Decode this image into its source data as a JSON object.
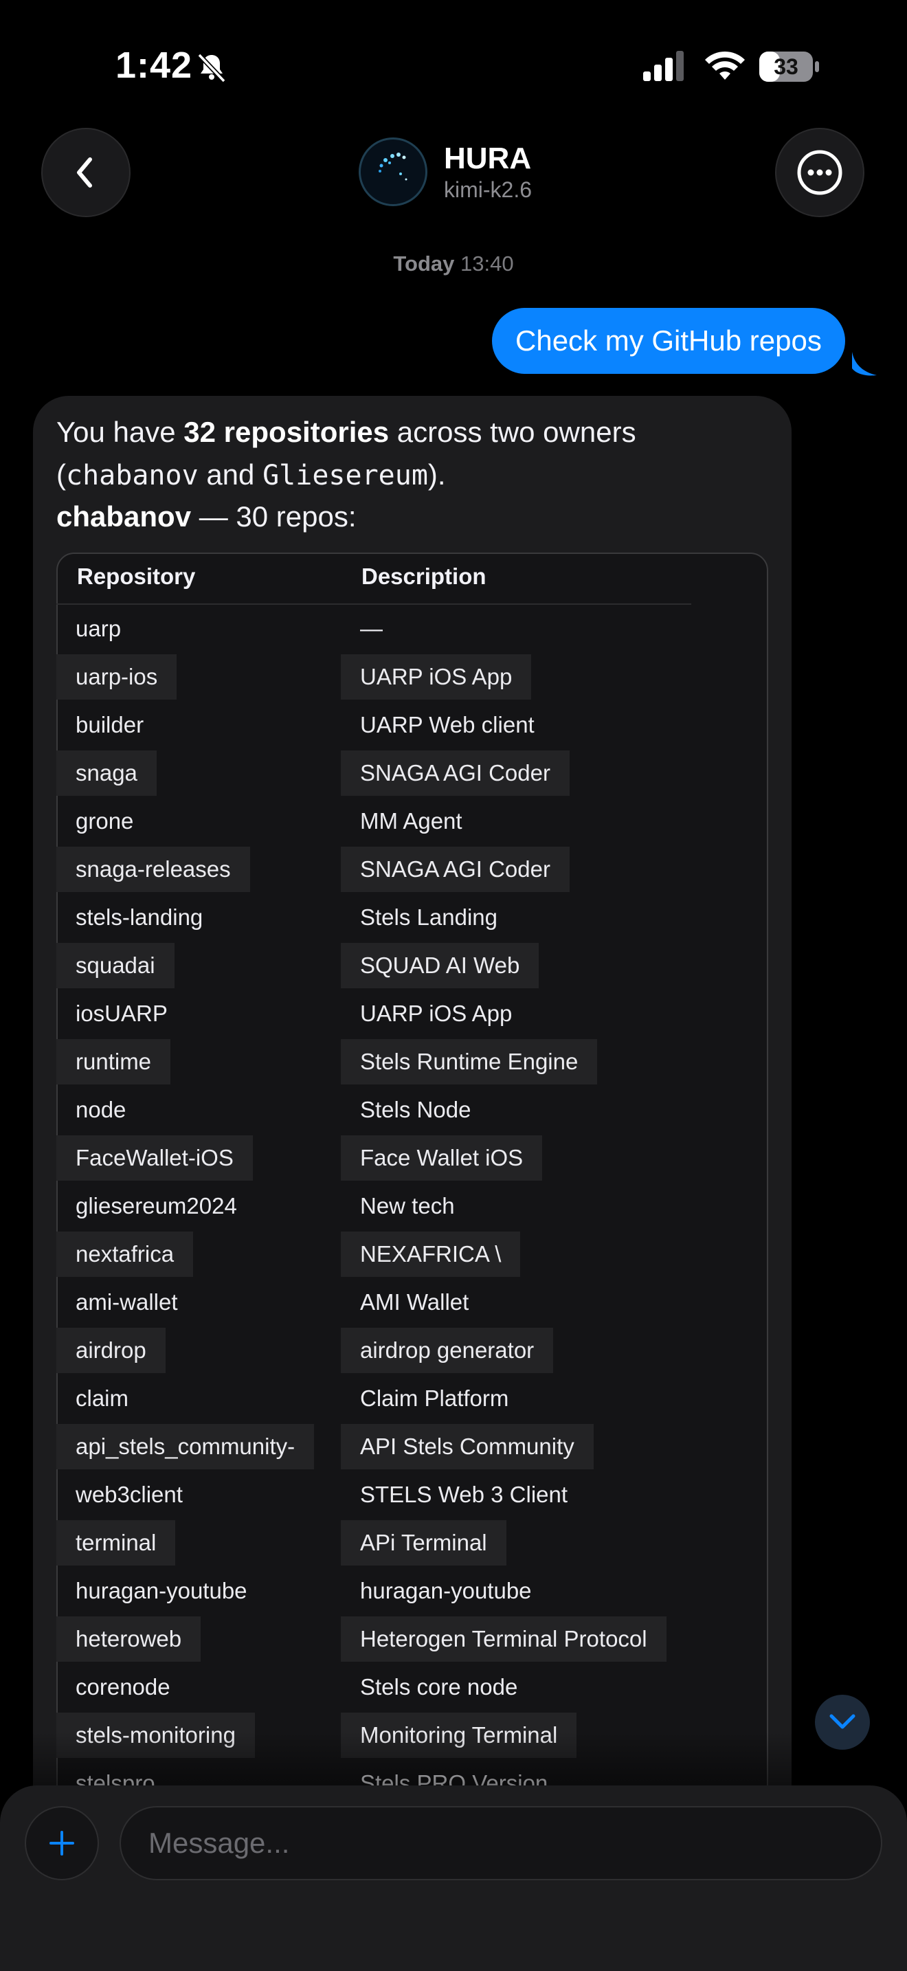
{
  "status_bar": {
    "time": "1:42",
    "battery": "33"
  },
  "header": {
    "title": "HURA",
    "subtitle": "kimi-k2.6"
  },
  "date_separator": {
    "day": "Today",
    "time": "13:40"
  },
  "user_message": "Check my GitHub repos",
  "assistant": {
    "intro_1": "You have ",
    "intro_bold": "32 repositories",
    "intro_2": " across two owners (",
    "owner_a": "chabanov",
    "intro_and": " and ",
    "owner_b": "Gliesereum",
    "intro_end": ").",
    "owner_heading_bold": "chabanov",
    "owner_heading_rest": " — 30 repos:",
    "table": {
      "headers": [
        "Repository",
        "Description"
      ],
      "rows": [
        [
          "uarp",
          "—"
        ],
        [
          "uarp-ios",
          "UARP iOS App"
        ],
        [
          "builder",
          "UARP Web client"
        ],
        [
          "snaga",
          "SNAGA AGI Coder"
        ],
        [
          "grone",
          "MM Agent"
        ],
        [
          "snaga-releases",
          "SNAGA AGI Coder"
        ],
        [
          "stels-landing",
          "Stels Landing"
        ],
        [
          "squadai",
          "SQUAD AI Web"
        ],
        [
          "iosUARP",
          "UARP iOS App"
        ],
        [
          "runtime",
          "Stels Runtime Engine"
        ],
        [
          "node",
          "Stels Node"
        ],
        [
          "FaceWallet-iOS",
          "Face Wallet iOS"
        ],
        [
          "gliesereum2024",
          "New tech"
        ],
        [
          "nextafrica",
          "NEXAFRICA \\"
        ],
        [
          "ami-wallet",
          "AMI Wallet"
        ],
        [
          "airdrop",
          "airdrop generator"
        ],
        [
          "claim",
          "Claim Platform"
        ],
        [
          "api_stels_community-",
          "API Stels Community"
        ],
        [
          "web3client",
          "STELS Web 3 Client"
        ],
        [
          "terminal",
          "APi Terminal"
        ],
        [
          "huragan-youtube",
          "huragan-youtube"
        ],
        [
          "heteroweb",
          "Heterogen Terminal Protocol"
        ],
        [
          "corenode",
          "Stels core node"
        ],
        [
          "stels-monitoring",
          "Monitoring Terminal"
        ],
        [
          "stelspro",
          "Stels PRO Version"
        ]
      ]
    }
  },
  "composer": {
    "placeholder": "Message..."
  },
  "colors": {
    "accent": "#0a84ff",
    "bubble": "#1c1c1e",
    "background": "#000000"
  }
}
